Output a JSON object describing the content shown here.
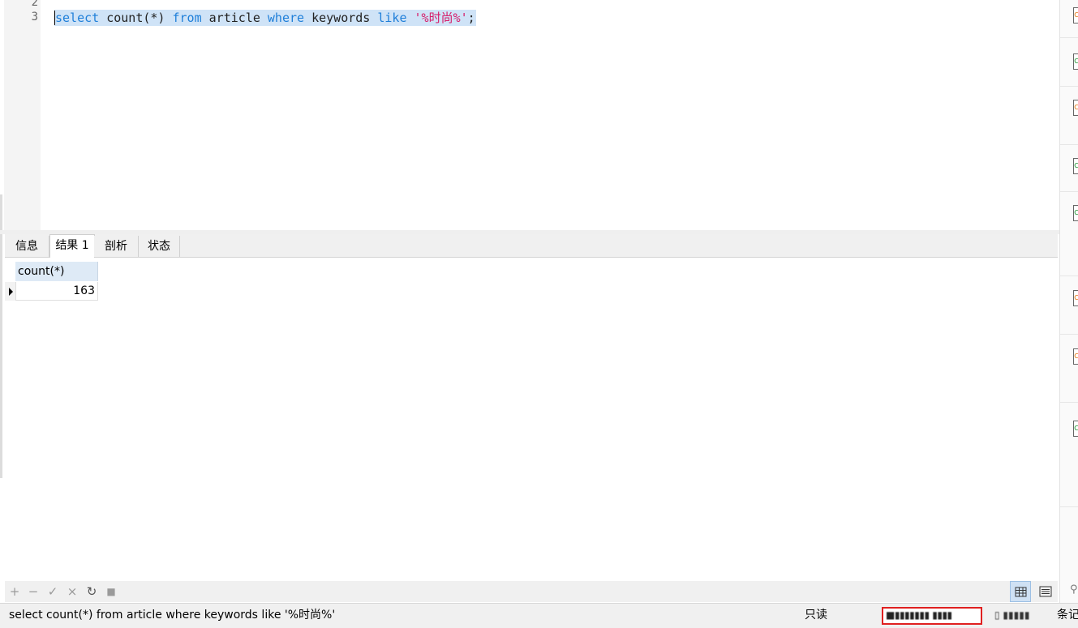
{
  "editor": {
    "line_numbers": [
      "2",
      "3"
    ],
    "sql_tokens": [
      {
        "text": "select",
        "kind": "kw"
      },
      {
        "text": " count(*) ",
        "kind": "plain"
      },
      {
        "text": "from",
        "kind": "kw"
      },
      {
        "text": " article ",
        "kind": "plain"
      },
      {
        "text": "where",
        "kind": "kw"
      },
      {
        "text": " keywords ",
        "kind": "plain"
      },
      {
        "text": "like",
        "kind": "kw"
      },
      {
        "text": " ",
        "kind": "plain"
      },
      {
        "text": "'%时尚%'",
        "kind": "str"
      },
      {
        "text": ";",
        "kind": "plain"
      }
    ]
  },
  "tabs": [
    {
      "label": "信息",
      "active": false
    },
    {
      "label": "结果 1",
      "active": true
    },
    {
      "label": "剖析",
      "active": false
    },
    {
      "label": "状态",
      "active": false
    }
  ],
  "result": {
    "column_header": "count(*)",
    "cell_value": "163"
  },
  "toolbar": {
    "buttons": [
      {
        "name": "add-row-button",
        "glyph": "+",
        "icon": "plus-icon"
      },
      {
        "name": "delete-row-button",
        "glyph": "−",
        "icon": "minus-icon"
      },
      {
        "name": "apply-button",
        "glyph": "✓",
        "icon": "check-icon"
      },
      {
        "name": "discard-button",
        "glyph": "×",
        "icon": "cross-icon"
      },
      {
        "name": "refresh-button",
        "glyph": "↻",
        "icon": "refresh-icon"
      },
      {
        "name": "stop-button",
        "glyph": "■",
        "icon": "stop-icon"
      }
    ],
    "grid_view_icon": "grid-view-icon",
    "form_view_icon": "form-view-icon"
  },
  "statusbar": {
    "sql_text": "select count(*) from article where keywords like '%时尚%'",
    "readonly_text": "只读",
    "records_text": "条记"
  },
  "colors": {
    "keyword": "#1f7fd9",
    "string": "#d61d6a",
    "selection": "#cfe3f7",
    "highlight_box": "#e02020",
    "header_bg": "#deeaf6"
  }
}
